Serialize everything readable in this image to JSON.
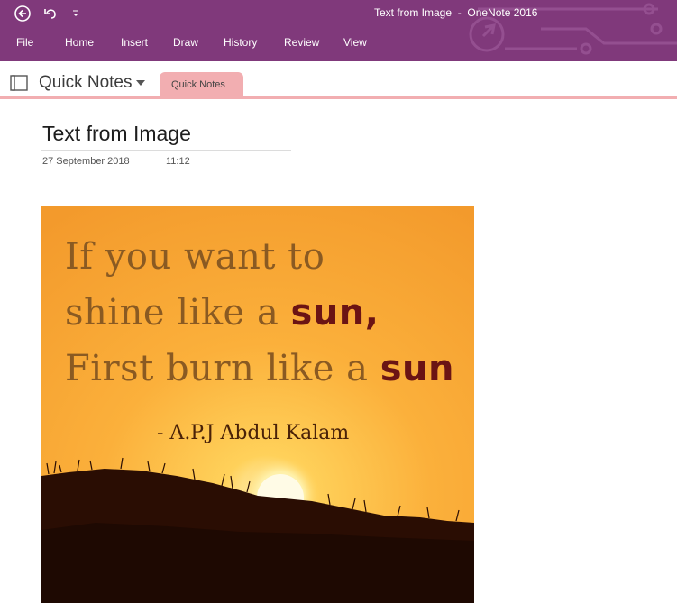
{
  "window": {
    "title": "Text from Image  -  OneNote 2016",
    "quick_access": [
      "back-icon",
      "undo-icon",
      "customize-toolbar-icon"
    ]
  },
  "menu": {
    "file": "File",
    "home": "Home",
    "insert": "Insert",
    "draw": "Draw",
    "history": "History",
    "review": "Review",
    "view": "View"
  },
  "notebook": {
    "name": "Quick Notes",
    "section_tab": "Quick Notes"
  },
  "page": {
    "title": "Text from Image",
    "date": "27 September 2018",
    "time": "11:12"
  },
  "image": {
    "line1": "If you want to",
    "line2_pre": "shine like a ",
    "line2_bold": "sun,",
    "line3_pre": "First burn like a ",
    "line3_bold": "sun",
    "author": "- A.P.J Abdul Kalam"
  },
  "colors": {
    "ribbon": "#80397b",
    "section_tab": "#f2aeb1",
    "quote_text": "#8a5a22",
    "quote_emphasis": "#6b1414"
  }
}
